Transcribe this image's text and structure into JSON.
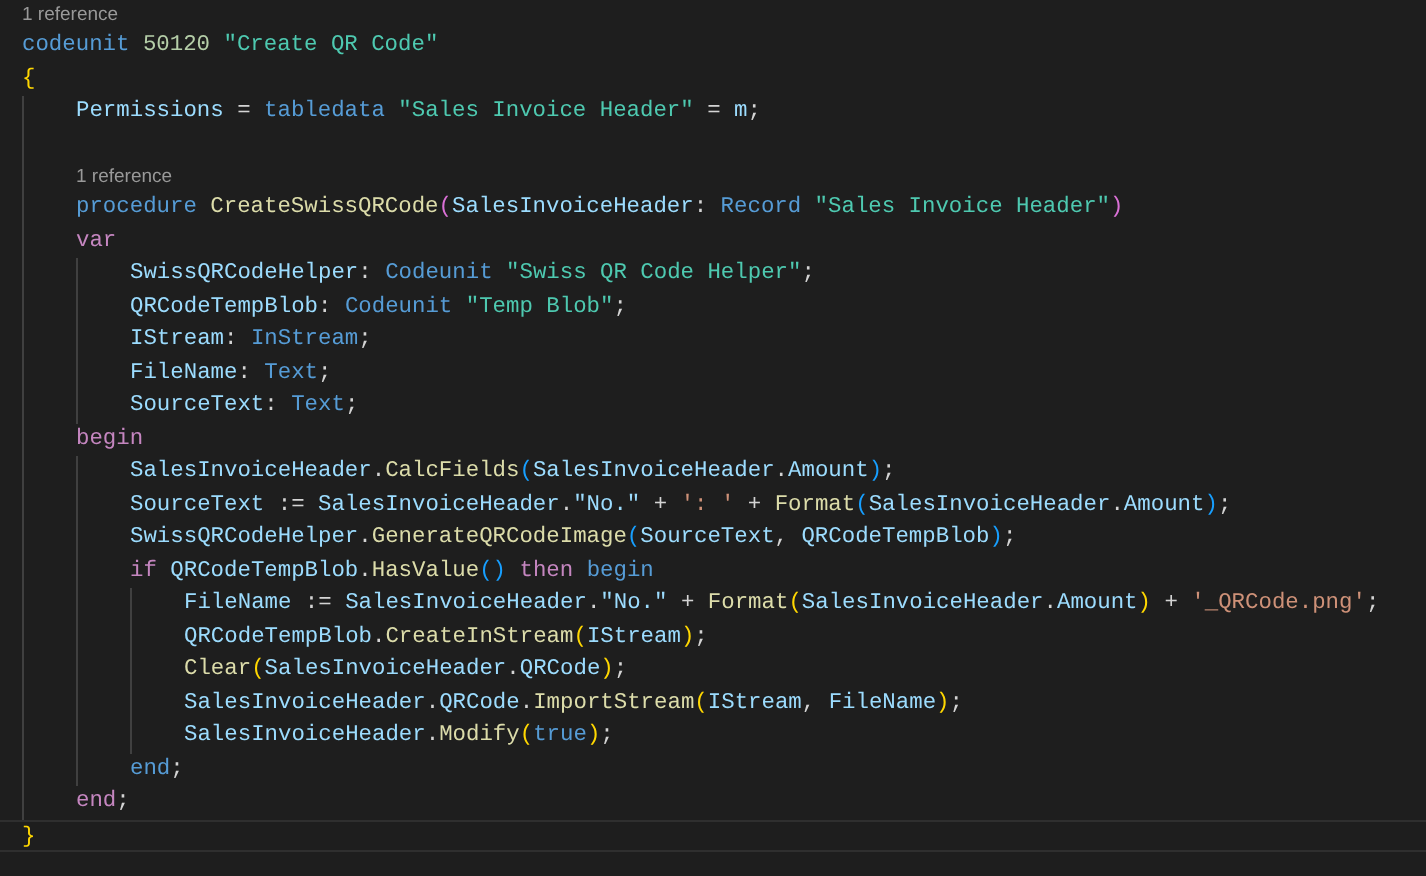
{
  "editor": {
    "lines": [
      {
        "kind": "lens",
        "text": "1 reference"
      },
      {
        "kind": "code",
        "tokens": [
          {
            "text": "codeunit ",
            "kind": "keyword"
          },
          {
            "text": "50120 ",
            "kind": "number"
          },
          {
            "text": "\"Create QR Code\"",
            "kind": "name"
          }
        ]
      },
      {
        "kind": "code",
        "tokens": [
          {
            "text": "{",
            "kind": "bracket1"
          }
        ],
        "children": [
          {
            "kind": "code",
            "tokens": [
              {
                "text": "Permissions",
                "kind": "variable"
              },
              {
                "text": " = ",
                "kind": "plain"
              },
              {
                "text": "tabledata ",
                "kind": "keyword"
              },
              {
                "text": "\"Sales Invoice Header\"",
                "kind": "name"
              },
              {
                "text": " = ",
                "kind": "plain"
              },
              {
                "text": "m",
                "kind": "variable"
              },
              {
                "text": ";",
                "kind": "plain"
              }
            ]
          },
          {
            "kind": "blank"
          },
          {
            "kind": "lens",
            "text": "1 reference"
          },
          {
            "kind": "code",
            "tokens": [
              {
                "text": "procedure ",
                "kind": "keyword"
              },
              {
                "text": "CreateSwissQRCode",
                "kind": "function"
              },
              {
                "text": "(",
                "kind": "bracket2"
              },
              {
                "text": "SalesInvoiceHeader",
                "kind": "variable"
              },
              {
                "text": ": ",
                "kind": "plain"
              },
              {
                "text": "Record ",
                "kind": "keyword"
              },
              {
                "text": "\"Sales Invoice Header\"",
                "kind": "name"
              },
              {
                "text": ")",
                "kind": "bracket2"
              }
            ]
          },
          {
            "kind": "code",
            "tokens": [
              {
                "text": "var",
                "kind": "control"
              }
            ],
            "children": [
              {
                "kind": "code",
                "tokens": [
                  {
                    "text": "SwissQRCodeHelper",
                    "kind": "variable"
                  },
                  {
                    "text": ": ",
                    "kind": "plain"
                  },
                  {
                    "text": "Codeunit ",
                    "kind": "keyword"
                  },
                  {
                    "text": "\"Swiss QR Code Helper\"",
                    "kind": "name"
                  },
                  {
                    "text": ";",
                    "kind": "plain"
                  }
                ]
              },
              {
                "kind": "code",
                "tokens": [
                  {
                    "text": "QRCodeTempBlob",
                    "kind": "variable"
                  },
                  {
                    "text": ": ",
                    "kind": "plain"
                  },
                  {
                    "text": "Codeunit ",
                    "kind": "keyword"
                  },
                  {
                    "text": "\"Temp Blob\"",
                    "kind": "name"
                  },
                  {
                    "text": ";",
                    "kind": "plain"
                  }
                ]
              },
              {
                "kind": "code",
                "tokens": [
                  {
                    "text": "IStream",
                    "kind": "variable"
                  },
                  {
                    "text": ": ",
                    "kind": "plain"
                  },
                  {
                    "text": "InStream",
                    "kind": "keyword"
                  },
                  {
                    "text": ";",
                    "kind": "plain"
                  }
                ]
              },
              {
                "kind": "code",
                "tokens": [
                  {
                    "text": "FileName",
                    "kind": "variable"
                  },
                  {
                    "text": ": ",
                    "kind": "plain"
                  },
                  {
                    "text": "Text",
                    "kind": "keyword"
                  },
                  {
                    "text": ";",
                    "kind": "plain"
                  }
                ]
              },
              {
                "kind": "code",
                "tokens": [
                  {
                    "text": "SourceText",
                    "kind": "variable"
                  },
                  {
                    "text": ": ",
                    "kind": "plain"
                  },
                  {
                    "text": "Text",
                    "kind": "keyword"
                  },
                  {
                    "text": ";",
                    "kind": "plain"
                  }
                ]
              }
            ]
          },
          {
            "kind": "code",
            "tokens": [
              {
                "text": "begin",
                "kind": "control"
              }
            ],
            "children": [
              {
                "kind": "code",
                "tokens": [
                  {
                    "text": "SalesInvoiceHeader",
                    "kind": "variable"
                  },
                  {
                    "text": ".",
                    "kind": "plain"
                  },
                  {
                    "text": "CalcFields",
                    "kind": "function"
                  },
                  {
                    "text": "(",
                    "kind": "bracket3"
                  },
                  {
                    "text": "SalesInvoiceHeader",
                    "kind": "variable"
                  },
                  {
                    "text": ".",
                    "kind": "plain"
                  },
                  {
                    "text": "Amount",
                    "kind": "variable"
                  },
                  {
                    "text": ")",
                    "kind": "bracket3"
                  },
                  {
                    "text": ";",
                    "kind": "plain"
                  }
                ]
              },
              {
                "kind": "code",
                "tokens": [
                  {
                    "text": "SourceText",
                    "kind": "variable"
                  },
                  {
                    "text": " := ",
                    "kind": "plain"
                  },
                  {
                    "text": "SalesInvoiceHeader",
                    "kind": "variable"
                  },
                  {
                    "text": ".",
                    "kind": "plain"
                  },
                  {
                    "text": "\"No.\"",
                    "kind": "variable"
                  },
                  {
                    "text": " + ",
                    "kind": "plain"
                  },
                  {
                    "text": "': '",
                    "kind": "string"
                  },
                  {
                    "text": " + ",
                    "kind": "plain"
                  },
                  {
                    "text": "Format",
                    "kind": "function"
                  },
                  {
                    "text": "(",
                    "kind": "bracket3"
                  },
                  {
                    "text": "SalesInvoiceHeader",
                    "kind": "variable"
                  },
                  {
                    "text": ".",
                    "kind": "plain"
                  },
                  {
                    "text": "Amount",
                    "kind": "variable"
                  },
                  {
                    "text": ")",
                    "kind": "bracket3"
                  },
                  {
                    "text": ";",
                    "kind": "plain"
                  }
                ]
              },
              {
                "kind": "code",
                "tokens": [
                  {
                    "text": "SwissQRCodeHelper",
                    "kind": "variable"
                  },
                  {
                    "text": ".",
                    "kind": "plain"
                  },
                  {
                    "text": "GenerateQRCodeImage",
                    "kind": "function"
                  },
                  {
                    "text": "(",
                    "kind": "bracket3"
                  },
                  {
                    "text": "SourceText",
                    "kind": "variable"
                  },
                  {
                    "text": ", ",
                    "kind": "plain"
                  },
                  {
                    "text": "QRCodeTempBlob",
                    "kind": "variable"
                  },
                  {
                    "text": ")",
                    "kind": "bracket3"
                  },
                  {
                    "text": ";",
                    "kind": "plain"
                  }
                ]
              },
              {
                "kind": "code",
                "tokens": [
                  {
                    "text": "if ",
                    "kind": "control"
                  },
                  {
                    "text": "QRCodeTempBlob",
                    "kind": "variable"
                  },
                  {
                    "text": ".",
                    "kind": "plain"
                  },
                  {
                    "text": "HasValue",
                    "kind": "function"
                  },
                  {
                    "text": "()",
                    "kind": "bracket3"
                  },
                  {
                    "text": " then ",
                    "kind": "control"
                  },
                  {
                    "text": "begin",
                    "kind": "keyword"
                  }
                ],
                "children": [
                  {
                    "kind": "code",
                    "tokens": [
                      {
                        "text": "FileName",
                        "kind": "variable"
                      },
                      {
                        "text": " := ",
                        "kind": "plain"
                      },
                      {
                        "text": "SalesInvoiceHeader",
                        "kind": "variable"
                      },
                      {
                        "text": ".",
                        "kind": "plain"
                      },
                      {
                        "text": "\"No.\"",
                        "kind": "variable"
                      },
                      {
                        "text": " + ",
                        "kind": "plain"
                      },
                      {
                        "text": "Format",
                        "kind": "function"
                      },
                      {
                        "text": "(",
                        "kind": "bracket1"
                      },
                      {
                        "text": "SalesInvoiceHeader",
                        "kind": "variable"
                      },
                      {
                        "text": ".",
                        "kind": "plain"
                      },
                      {
                        "text": "Amount",
                        "kind": "variable"
                      },
                      {
                        "text": ")",
                        "kind": "bracket1"
                      },
                      {
                        "text": " + ",
                        "kind": "plain"
                      },
                      {
                        "text": "'_QRCode.png'",
                        "kind": "string"
                      },
                      {
                        "text": ";",
                        "kind": "plain"
                      }
                    ]
                  },
                  {
                    "kind": "code",
                    "tokens": [
                      {
                        "text": "QRCodeTempBlob",
                        "kind": "variable"
                      },
                      {
                        "text": ".",
                        "kind": "plain"
                      },
                      {
                        "text": "CreateInStream",
                        "kind": "function"
                      },
                      {
                        "text": "(",
                        "kind": "bracket1"
                      },
                      {
                        "text": "IStream",
                        "kind": "variable"
                      },
                      {
                        "text": ")",
                        "kind": "bracket1"
                      },
                      {
                        "text": ";",
                        "kind": "plain"
                      }
                    ]
                  },
                  {
                    "kind": "code",
                    "tokens": [
                      {
                        "text": "Clear",
                        "kind": "function"
                      },
                      {
                        "text": "(",
                        "kind": "bracket1"
                      },
                      {
                        "text": "SalesInvoiceHeader",
                        "kind": "variable"
                      },
                      {
                        "text": ".",
                        "kind": "plain"
                      },
                      {
                        "text": "QRCode",
                        "kind": "variable"
                      },
                      {
                        "text": ")",
                        "kind": "bracket1"
                      },
                      {
                        "text": ";",
                        "kind": "plain"
                      }
                    ]
                  },
                  {
                    "kind": "code",
                    "tokens": [
                      {
                        "text": "SalesInvoiceHeader",
                        "kind": "variable"
                      },
                      {
                        "text": ".",
                        "kind": "plain"
                      },
                      {
                        "text": "QRCode",
                        "kind": "variable"
                      },
                      {
                        "text": ".",
                        "kind": "plain"
                      },
                      {
                        "text": "ImportStream",
                        "kind": "function"
                      },
                      {
                        "text": "(",
                        "kind": "bracket1"
                      },
                      {
                        "text": "IStream",
                        "kind": "variable"
                      },
                      {
                        "text": ", ",
                        "kind": "plain"
                      },
                      {
                        "text": "FileName",
                        "kind": "variable"
                      },
                      {
                        "text": ")",
                        "kind": "bracket1"
                      },
                      {
                        "text": ";",
                        "kind": "plain"
                      }
                    ]
                  },
                  {
                    "kind": "code",
                    "tokens": [
                      {
                        "text": "SalesInvoiceHeader",
                        "kind": "variable"
                      },
                      {
                        "text": ".",
                        "kind": "plain"
                      },
                      {
                        "text": "Modify",
                        "kind": "function"
                      },
                      {
                        "text": "(",
                        "kind": "bracket1"
                      },
                      {
                        "text": "true",
                        "kind": "keyword"
                      },
                      {
                        "text": ")",
                        "kind": "bracket1"
                      },
                      {
                        "text": ";",
                        "kind": "plain"
                      }
                    ]
                  }
                ]
              },
              {
                "kind": "code",
                "tokens": [
                  {
                    "text": "end",
                    "kind": "keyword"
                  },
                  {
                    "text": ";",
                    "kind": "plain"
                  }
                ]
              }
            ]
          },
          {
            "kind": "code",
            "tokens": [
              {
                "text": "end",
                "kind": "control"
              },
              {
                "text": ";",
                "kind": "plain"
              }
            ]
          }
        ]
      },
      {
        "kind": "code",
        "current": true,
        "tokens": [
          {
            "text": "}",
            "kind": "bracket1"
          }
        ]
      }
    ]
  }
}
